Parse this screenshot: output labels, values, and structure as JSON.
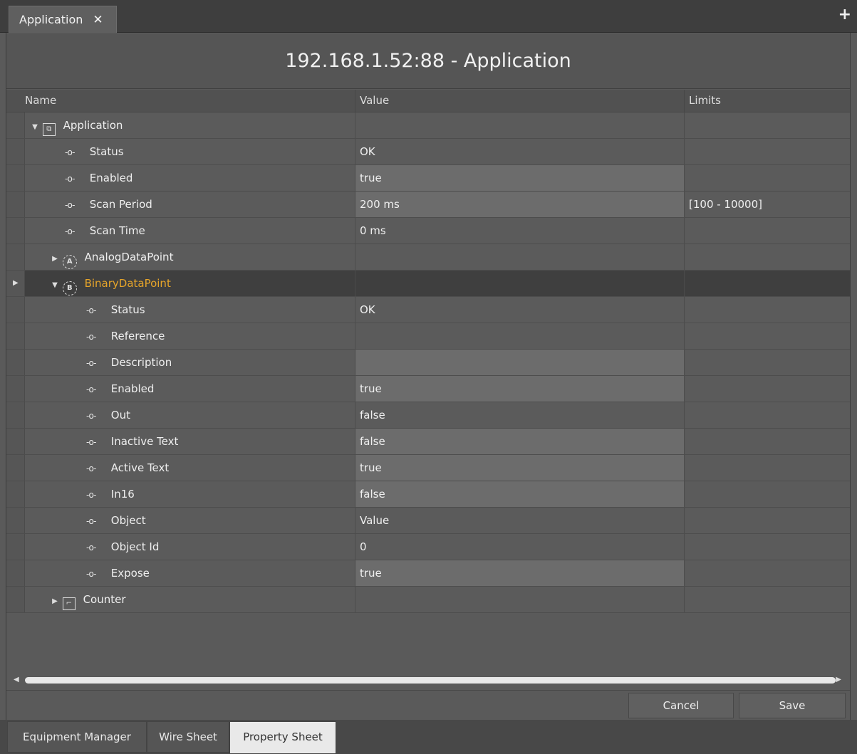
{
  "tab": {
    "label": "Application",
    "close": "✕"
  },
  "add_icon": "+",
  "title": "192.168.1.52:88 - Application",
  "columns": {
    "name": "Name",
    "value": "Value",
    "limits": "Limits"
  },
  "rows": [
    {
      "name": "Application",
      "value": "",
      "limits": ""
    },
    {
      "name": "Status",
      "value": "OK",
      "limits": ""
    },
    {
      "name": "Enabled",
      "value": "true",
      "limits": ""
    },
    {
      "name": "Scan Period",
      "value": "200 ms",
      "limits": "[100 - 10000]"
    },
    {
      "name": "Scan Time",
      "value": "0 ms",
      "limits": ""
    },
    {
      "name": "AnalogDataPoint",
      "value": "",
      "limits": ""
    },
    {
      "name": "BinaryDataPoint",
      "value": "",
      "limits": ""
    },
    {
      "name": "Status",
      "value": "OK",
      "limits": ""
    },
    {
      "name": "Reference",
      "value": "",
      "limits": ""
    },
    {
      "name": "Description",
      "value": "",
      "limits": ""
    },
    {
      "name": "Enabled",
      "value": "true",
      "limits": ""
    },
    {
      "name": "Out",
      "value": "false",
      "limits": ""
    },
    {
      "name": "Inactive Text",
      "value": "false",
      "limits": ""
    },
    {
      "name": "Active Text",
      "value": "true",
      "limits": ""
    },
    {
      "name": "In16",
      "value": "false",
      "limits": ""
    },
    {
      "name": "Object",
      "value": "Value",
      "limits": ""
    },
    {
      "name": "Object Id",
      "value": "0",
      "limits": ""
    },
    {
      "name": "Expose",
      "value": "true",
      "limits": ""
    },
    {
      "name": "Counter",
      "value": "",
      "limits": ""
    }
  ],
  "icons": {
    "slot": "-o-",
    "analog_badge": "A",
    "binary_badge": "B",
    "app_badge": "⧉",
    "counter_badge": "⌐"
  },
  "buttons": {
    "cancel": "Cancel",
    "save": "Save"
  },
  "bottom_tabs": [
    "Equipment Manager",
    "Wire Sheet",
    "Property Sheet"
  ],
  "colors": {
    "selected_text": "#e7a52a",
    "selected_row": "#3f3f3f",
    "editable_cell": "#6c6c6c"
  }
}
